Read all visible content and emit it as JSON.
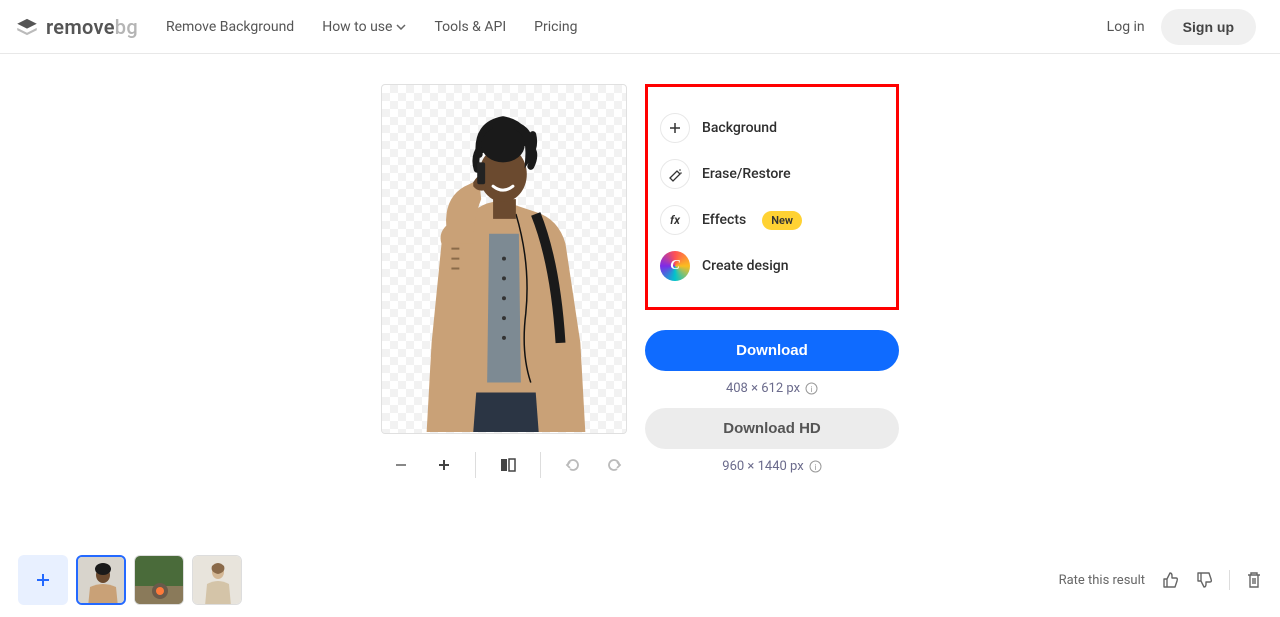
{
  "header": {
    "logo_primary": "remove",
    "logo_secondary": "bg",
    "nav": {
      "remove_bg": "Remove Background",
      "how_to_use": "How to use",
      "tools_api": "Tools & API",
      "pricing": "Pricing"
    },
    "login": "Log in",
    "signup": "Sign up"
  },
  "options": {
    "background": "Background",
    "erase_restore": "Erase/Restore",
    "effects": "Effects",
    "effects_badge": "New",
    "create_design": "Create design"
  },
  "download": {
    "primary": "Download",
    "primary_res": "408 × 612 px",
    "secondary": "Download HD",
    "secondary_res": "960 × 1440 px"
  },
  "footer": {
    "rate_label": "Rate this result"
  }
}
